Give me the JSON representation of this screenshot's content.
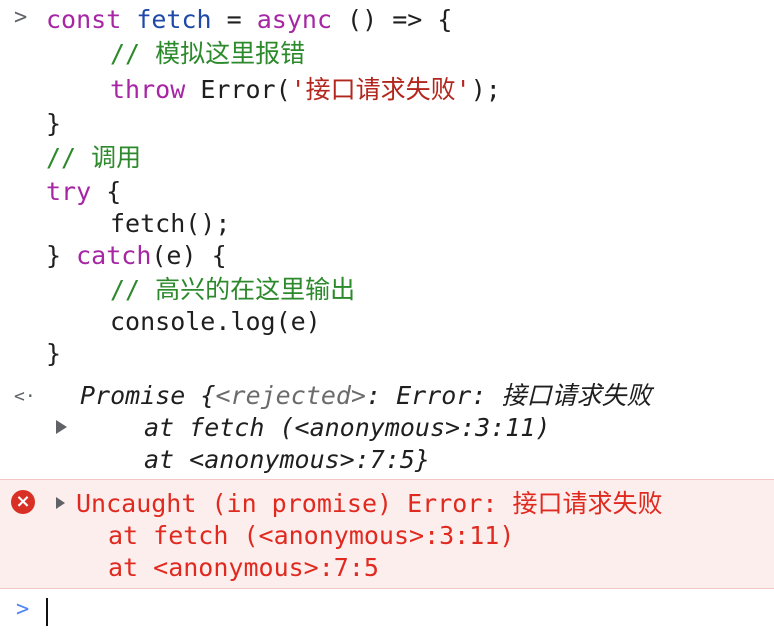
{
  "input": {
    "prompt_icon": "chevron-right-icon",
    "prompt_glyph": ">",
    "lines": [
      [
        {
          "t": "kw",
          "v": "const "
        },
        {
          "t": "fn",
          "v": "fetch"
        },
        {
          "t": "pl",
          "v": " = "
        },
        {
          "t": "kw",
          "v": "async"
        },
        {
          "t": "pl",
          "v": " () => {"
        }
      ],
      [
        {
          "t": "cm",
          "v": "// 模拟这里报错"
        }
      ],
      [
        {
          "t": "kw",
          "v": "throw "
        },
        {
          "t": "pl",
          "v": "Error("
        },
        {
          "t": "str",
          "v": "'接口请求失败'"
        },
        {
          "t": "pl",
          "v": ");"
        }
      ],
      [
        {
          "t": "pl",
          "v": "}"
        }
      ],
      [
        {
          "t": "cm",
          "v": "// 调用"
        }
      ],
      [
        {
          "t": "kw",
          "v": "try"
        },
        {
          "t": "pl",
          "v": " {"
        }
      ],
      [
        {
          "t": "pl",
          "v": "fetch();"
        }
      ],
      [
        {
          "t": "pl",
          "v": "} "
        },
        {
          "t": "kw",
          "v": "catch"
        },
        {
          "t": "pl",
          "v": "(e) {"
        }
      ],
      [
        {
          "t": "cm",
          "v": "// 高兴的在这里输出"
        }
      ],
      [
        {
          "t": "pl",
          "v": "console.log(e)"
        }
      ],
      [
        {
          "t": "pl",
          "v": "}"
        }
      ]
    ]
  },
  "result": {
    "icon": "return-arrow-icon",
    "icon_glyph": "<·",
    "line1_prefix": "Promise {",
    "line1_state": "<rejected>",
    "line1_suffix": ": Error: 接口请求失败",
    "line2": "at fetch (<anonymous>:3:11)",
    "line3": "at <anonymous>:7:5}"
  },
  "error": {
    "icon": "error-icon",
    "icon_glyph": "×",
    "line1": "Uncaught (in promise) Error: 接口请求失败",
    "line2": "at fetch (<anonymous>:3:11)",
    "line3": "at <anonymous>:7:5"
  },
  "prompt": {
    "icon": "chevron-right-icon",
    "glyph": ">"
  }
}
